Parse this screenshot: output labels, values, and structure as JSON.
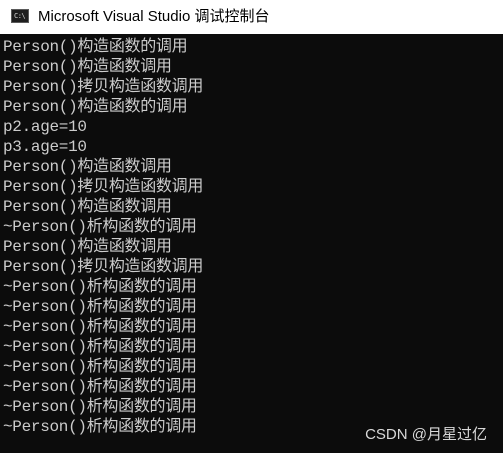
{
  "window": {
    "title": "Microsoft Visual Studio 调试控制台",
    "icon": "console-app-icon",
    "icon_glyph": "C:\\"
  },
  "console": {
    "lines": [
      "Person()构造函数的调用",
      "Person()构造函数调用",
      "Person()拷贝构造函数调用",
      "Person()构造函数的调用",
      "p2.age=10",
      "p3.age=10",
      "Person()构造函数调用",
      "Person()拷贝构造函数调用",
      "Person()构造函数调用",
      "~Person()析构函数的调用",
      "Person()构造函数调用",
      "Person()拷贝构造函数调用",
      "~Person()析构函数的调用",
      "~Person()析构函数的调用",
      "~Person()析构函数的调用",
      "~Person()析构函数的调用",
      "~Person()析构函数的调用",
      "~Person()析构函数的调用",
      "~Person()析构函数的调用",
      "~Person()析构函数的调用"
    ]
  },
  "watermark": "CSDN @月星过亿",
  "colors": {
    "console_background": "#0c0c0c",
    "console_text": "#cccccc",
    "titlebar_background": "#ffffff"
  }
}
